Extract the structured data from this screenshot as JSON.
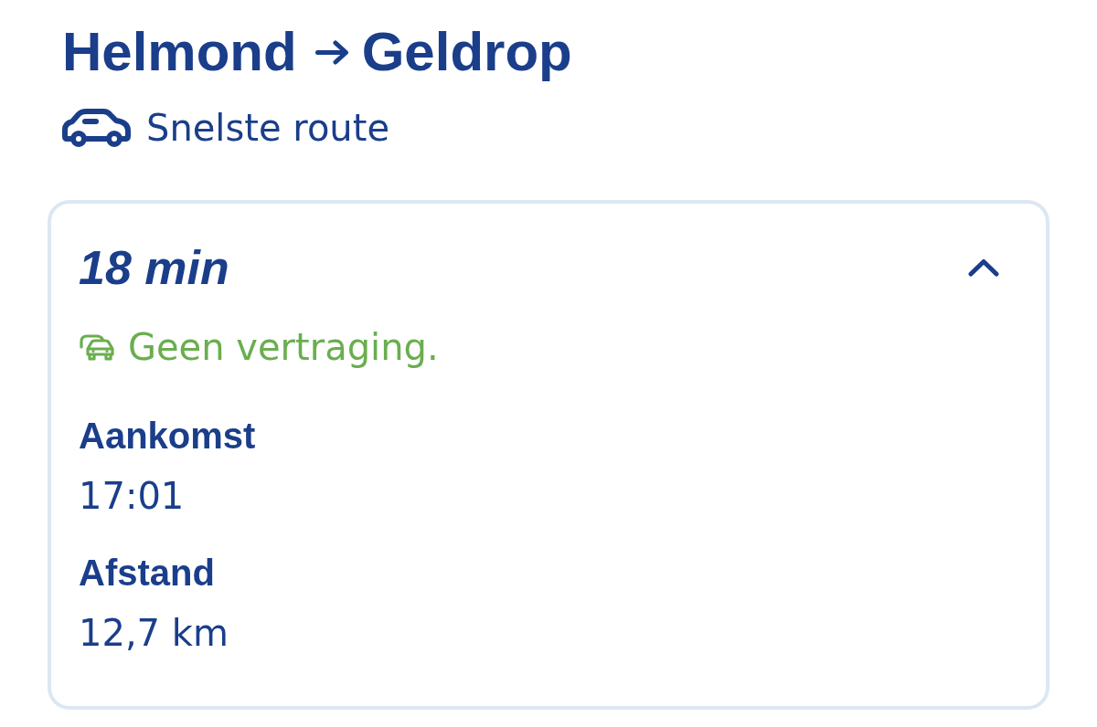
{
  "route": {
    "origin": "Helmond",
    "destination": "Geldrop"
  },
  "mode": {
    "label": "Snelste route"
  },
  "card": {
    "duration": "18 min",
    "expanded": true,
    "status": {
      "text": "Geen vertraging.",
      "delayed": false
    },
    "details": [
      {
        "label": "Aankomst",
        "value": "17:01"
      },
      {
        "label": "Afstand",
        "value": "12,7 km"
      }
    ]
  }
}
